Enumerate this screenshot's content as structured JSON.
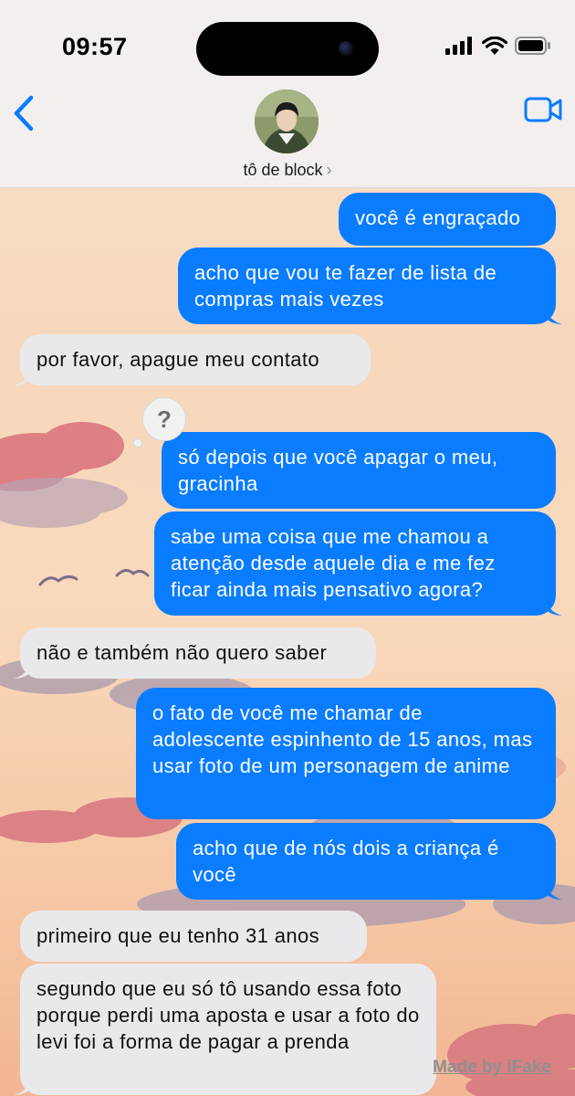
{
  "status_bar": {
    "time": "09:57"
  },
  "header": {
    "contact_name": "tô de block",
    "chevron": "›",
    "back_icon": "chevron-left-icon",
    "video_icon": "video-camera-icon",
    "accent_color": "#0a7cff"
  },
  "messages": [
    {
      "direction": "out",
      "text": "você é engraçado"
    },
    {
      "direction": "out",
      "text": "acho que vou te fazer de lista de compras mais vezes"
    },
    {
      "direction": "in",
      "text": "por favor, apague meu contato"
    },
    {
      "direction": "out",
      "text": "só depois que você apagar o meu, gracinha"
    },
    {
      "direction": "out",
      "text": "sabe uma coisa que me chamou a atenção desde aquele dia e me fez ficar ainda mais pensativo agora?"
    },
    {
      "direction": "in",
      "text": "não e também não quero saber"
    },
    {
      "direction": "out",
      "text": "o fato de você me chamar de adolescente espinhento de 15 anos, mas usar foto de um personagem de anime"
    },
    {
      "direction": "out",
      "text": "acho que de nós dois a criança é você"
    },
    {
      "direction": "in",
      "text": "primeiro que eu tenho 31 anos"
    },
    {
      "direction": "in",
      "text": "segundo que eu só tô usando essa foto porque perdi uma aposta e usar a foto do levi foi a forma de pagar a prenda"
    }
  ],
  "reaction": {
    "symbol": "?"
  },
  "watermark": "Made by iFake",
  "colors": {
    "outgoing_bubble": "#0a7cff",
    "incoming_bubble": "#e9e9eb"
  }
}
